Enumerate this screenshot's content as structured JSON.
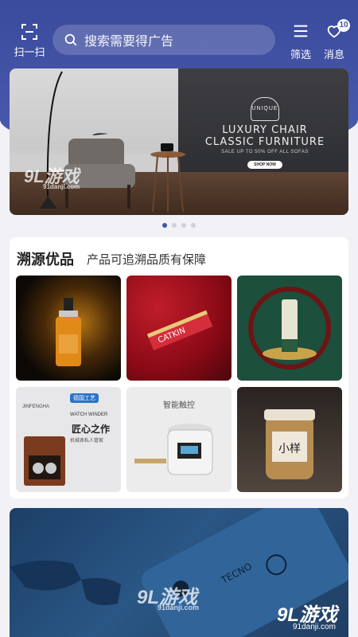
{
  "header": {
    "scan_label": "扫一扫",
    "search_placeholder": "搜索需要得广告",
    "filter_label": "筛选",
    "message_label": "消息",
    "message_badge": "10",
    "accent_color": "#4454a6"
  },
  "banner": {
    "brand_seal": "UNIQUE",
    "line1": "LUXURY CHAIR",
    "line2": "CLASSIC FURNITURE",
    "line3": "SALE UP TO 50% OFF ALL SOFAS",
    "cta": "SHOP NOW",
    "slide_count": 4,
    "active_slide": 1
  },
  "section": {
    "title": "溯源优品",
    "subtitle": "产品可追溯品质有保障",
    "tiles": [
      {
        "name": "serum-bottle",
        "text": ""
      },
      {
        "name": "red-lipstick",
        "text": "CATKIN"
      },
      {
        "name": "green-tube",
        "text": ""
      },
      {
        "name": "watch-winder",
        "brand": "JINFENGHA",
        "tag": "德国工艺",
        "en": "WATCH WINDER",
        "cn": "匠心之作",
        "sub": "机械表私人管家"
      },
      {
        "name": "rice-cooker",
        "cn": "智能触控"
      },
      {
        "name": "sauce-jar",
        "cn": "小样"
      }
    ]
  },
  "watermarks": {
    "site": "91danji.com",
    "brand": "9L游戏"
  },
  "bottom_banner": {
    "brand_text": "TECNO"
  }
}
